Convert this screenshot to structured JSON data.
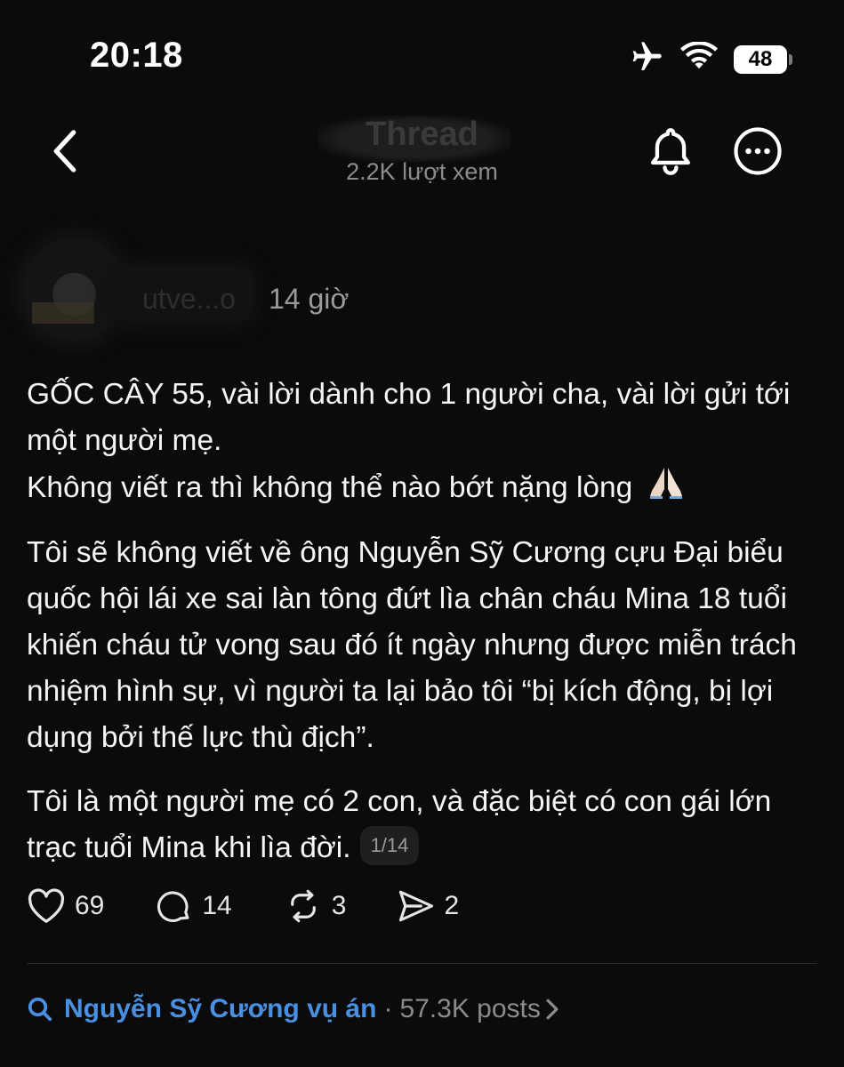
{
  "status_bar": {
    "time": "20:18",
    "battery": "48",
    "icons": [
      "airplane-icon",
      "wifi-icon",
      "battery-icon"
    ]
  },
  "header": {
    "title": "Thread",
    "views": "2.2K lượt xem"
  },
  "post": {
    "author": "utve...o",
    "time": "14 giờ",
    "paragraph1_line1": "GỐC CÂY 55, vài lời dành cho 1 người cha, vài lời gửi tới một người mẹ.",
    "paragraph1_line2": "Không viết ra thì không thể nào bớt nặng lòng",
    "paragraph2": "Tôi sẽ không viết về ông Nguyễn Sỹ Cương cựu Đại biểu quốc hội lái xe sai làn tông đứt lìa chân cháu Mina 18 tuổi khiến cháu tử vong sau đó ít ngày nhưng được miễn trách nhiệm hình sự, vì người ta lại bảo tôi “bị kích động, bị lợi dụng bởi thế lực thù địch”.",
    "paragraph3": "Tôi là một người mẹ có 2 con, và đặc biệt có con gái lớn trạc tuổi Mina khi lìa đời.",
    "page_indicator": "1/14"
  },
  "actions": {
    "likes": "69",
    "replies": "14",
    "reposts": "3",
    "shares": "2"
  },
  "topic": {
    "name": "Nguyễn Sỹ Cương vụ án",
    "separator": "·",
    "count": "57.3K posts"
  },
  "colors": {
    "background": "#0b0b0c",
    "text": "#f3f5f7",
    "muted": "#8b8b8b",
    "link": "#4a90e2"
  }
}
